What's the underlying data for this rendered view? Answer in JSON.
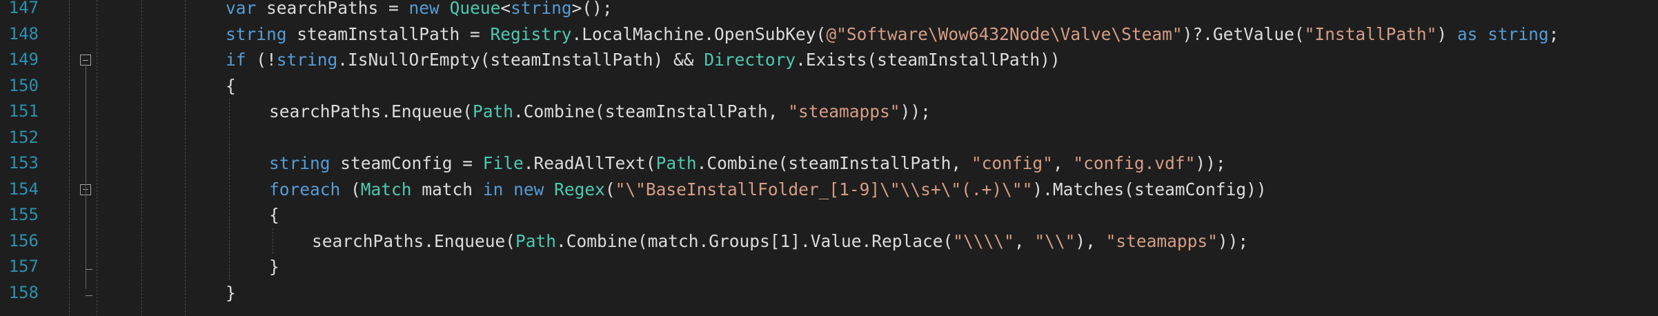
{
  "editor": {
    "theme_colors": {
      "background": "#1e1e1e",
      "line_number": "#2b91af",
      "keyword": "#569cd6",
      "type": "#4ec9b0",
      "string": "#d69d85",
      "plain": "#dcdcdc"
    },
    "lines": [
      {
        "number": "147",
        "tokens": [
          {
            "c": "k",
            "v": "var"
          },
          {
            "c": "p",
            "v": " searchPaths = "
          },
          {
            "c": "k",
            "v": "new"
          },
          {
            "c": "p",
            "v": " "
          },
          {
            "c": "t",
            "v": "Queue"
          },
          {
            "c": "p",
            "v": "<"
          },
          {
            "c": "k",
            "v": "string"
          },
          {
            "c": "p",
            "v": ">();"
          }
        ]
      },
      {
        "number": "148",
        "tokens": [
          {
            "c": "k",
            "v": "string"
          },
          {
            "c": "p",
            "v": " steamInstallPath = "
          },
          {
            "c": "t",
            "v": "Registry"
          },
          {
            "c": "p",
            "v": ".LocalMachine.OpenSubKey("
          },
          {
            "c": "s",
            "v": "@\"Software\\Wow6432Node\\Valve\\Steam\""
          },
          {
            "c": "p",
            "v": ")?.GetValue("
          },
          {
            "c": "s",
            "v": "\"InstallPath\""
          },
          {
            "c": "p",
            "v": ") "
          },
          {
            "c": "k",
            "v": "as"
          },
          {
            "c": "p",
            "v": " "
          },
          {
            "c": "k",
            "v": "string"
          },
          {
            "c": "p",
            "v": ";"
          }
        ]
      },
      {
        "number": "149",
        "tokens": [
          {
            "c": "k",
            "v": "if"
          },
          {
            "c": "p",
            "v": " (!"
          },
          {
            "c": "k",
            "v": "string"
          },
          {
            "c": "p",
            "v": ".IsNullOrEmpty(steamInstallPath) && "
          },
          {
            "c": "t",
            "v": "Directory"
          },
          {
            "c": "p",
            "v": ".Exists(steamInstallPath))"
          }
        ]
      },
      {
        "number": "150",
        "tokens": [
          {
            "c": "p",
            "v": "{"
          }
        ]
      },
      {
        "number": "151",
        "tokens": [
          {
            "c": "p",
            "v": "searchPaths.Enqueue("
          },
          {
            "c": "t",
            "v": "Path"
          },
          {
            "c": "p",
            "v": ".Combine(steamInstallPath, "
          },
          {
            "c": "s",
            "v": "\"steamapps\""
          },
          {
            "c": "p",
            "v": "));"
          }
        ]
      },
      {
        "number": "152",
        "tokens": []
      },
      {
        "number": "153",
        "tokens": [
          {
            "c": "k",
            "v": "string"
          },
          {
            "c": "p",
            "v": " steamConfig = "
          },
          {
            "c": "t",
            "v": "File"
          },
          {
            "c": "p",
            "v": ".ReadAllText("
          },
          {
            "c": "t",
            "v": "Path"
          },
          {
            "c": "p",
            "v": ".Combine(steamInstallPath, "
          },
          {
            "c": "s",
            "v": "\"config\""
          },
          {
            "c": "p",
            "v": ", "
          },
          {
            "c": "s",
            "v": "\"config.vdf\""
          },
          {
            "c": "p",
            "v": "));"
          }
        ]
      },
      {
        "number": "154",
        "tokens": [
          {
            "c": "k",
            "v": "foreach"
          },
          {
            "c": "p",
            "v": " ("
          },
          {
            "c": "t",
            "v": "Match"
          },
          {
            "c": "p",
            "v": " match "
          },
          {
            "c": "k",
            "v": "in"
          },
          {
            "c": "p",
            "v": " "
          },
          {
            "c": "k",
            "v": "new"
          },
          {
            "c": "p",
            "v": " "
          },
          {
            "c": "t",
            "v": "Regex"
          },
          {
            "c": "p",
            "v": "("
          },
          {
            "c": "s",
            "v": "\"\\\"BaseInstallFolder_[1-9]\\\"\\\\s+\\\"(.+)\\\"\""
          },
          {
            "c": "p",
            "v": ").Matches(steamConfig))"
          }
        ]
      },
      {
        "number": "155",
        "tokens": [
          {
            "c": "p",
            "v": "{"
          }
        ]
      },
      {
        "number": "156",
        "tokens": [
          {
            "c": "p",
            "v": "searchPaths.Enqueue("
          },
          {
            "c": "t",
            "v": "Path"
          },
          {
            "c": "p",
            "v": ".Combine(match.Groups[1].Value.Replace("
          },
          {
            "c": "s",
            "v": "\"\\\\\\\\\""
          },
          {
            "c": "p",
            "v": ", "
          },
          {
            "c": "s",
            "v": "\"\\\\\""
          },
          {
            "c": "p",
            "v": "), "
          },
          {
            "c": "s",
            "v": "\"steamapps\""
          },
          {
            "c": "p",
            "v": "));"
          }
        ]
      },
      {
        "number": "157",
        "tokens": [
          {
            "c": "p",
            "v": "}"
          }
        ]
      },
      {
        "number": "158",
        "tokens": [
          {
            "c": "p",
            "v": "}"
          }
        ]
      }
    ]
  }
}
